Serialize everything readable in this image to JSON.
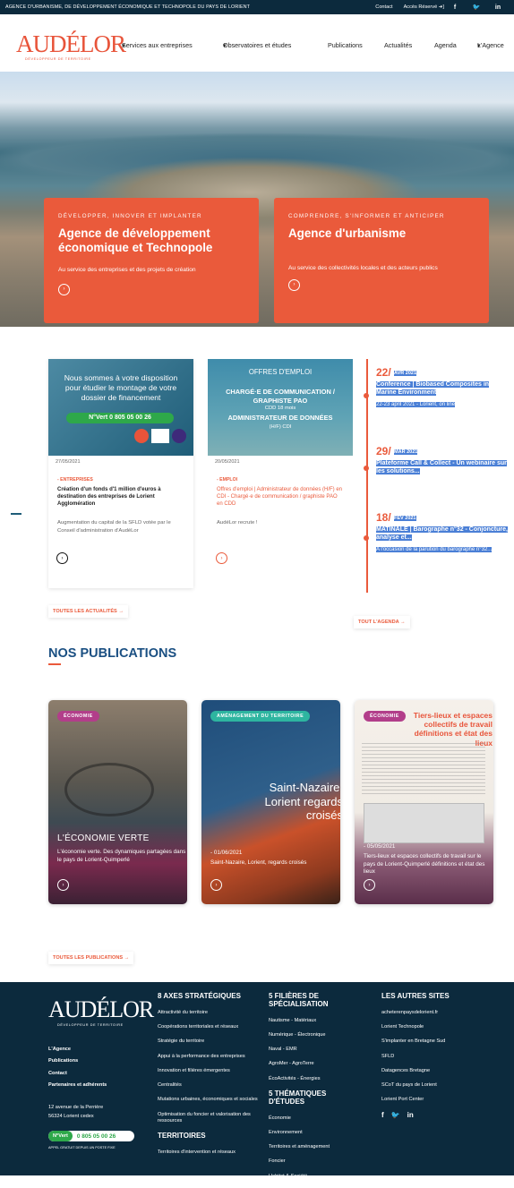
{
  "topbar": {
    "tagline": "AGENCE D'URBANISME, DE DÉVELOPPEMENT ÉCONOMIQUE ET TECHNOPOLE DU PAYS DE LORIENT",
    "contact": "Contact",
    "acces": "Accès Réservé"
  },
  "nav": {
    "logo": "AUDÉLOR",
    "logo_sub": "DÉVELOPPEUR DE TERRITOIRE",
    "items": [
      "Services aux entreprises",
      "Observatoires et études",
      "Publications",
      "Actualités",
      "Agenda",
      "L'Agence"
    ]
  },
  "hero": {
    "card1": {
      "kicker": "DÉVELOPPER, INNOVER ET IMPLANTER",
      "title": "Agence de développement économique et Technopole",
      "desc": "Au service des entreprises et des projets de création"
    },
    "card2": {
      "kicker": "COMPRENDRE, S'INFORMER ET ANTICIPER",
      "title": "Agence d'urbanisme",
      "desc": "Au service des collectivités locales et des acteurs publics"
    }
  },
  "news": [
    {
      "img_text": "Nous sommes à votre disposition pour étudier le montage de votre dossier de financement",
      "img_badge": "N°Vert 0 805 05 00 26",
      "date": "27/05/2021",
      "category": "- ENTREPRISES",
      "title": "Création d'un fonds d'1 million d'euros à destination des entreprises de Lorient Agglomération",
      "desc": "Augmentation du capital de la SFLD votée par le Conseil d'administration d'AudéLor"
    },
    {
      "img_line1": "OFFRES D'EMPLOI",
      "img_line2": "CHARGÉ·E DE COMMUNICATION / GRAPHISTE PAO",
      "img_line3": "CDD 18 mois",
      "img_line4": "ADMINISTRATEUR DE DONNÉES",
      "img_line5": "(H/F) CDI",
      "date": "20/05/2021",
      "category": "- EMPLOI",
      "title": "Offres d'emploi | Administrateur de données (H/F) en CDI - Chargé·e de communication / graphiste PAO en CDD",
      "desc": "AudéLor recrute !"
    }
  ],
  "agenda": [
    {
      "day": "22",
      "month": "AVR 2021",
      "title": "Conference | Biobased Composites in Marine Environment",
      "sub": "22-23 april 2021 - Lorient, on line"
    },
    {
      "day": "29",
      "month": "MAR 2021",
      "title": "Plateforme Call & Collect - Un webinaire sur les solutions...",
      "sub": ""
    },
    {
      "day": "18",
      "month": "FEV 2021",
      "title": "MATINALE | Barographe n°32 - Conjoncture, analyse et...",
      "sub": "A l'occasion de la parution du barographe n°32..."
    }
  ],
  "links": {
    "all_news": "TOUTES LES ACTUALITÉS →",
    "all_agenda": "TOUT L'AGENDA →",
    "all_pubs": "TOUTES LES PUBLICATIONS →"
  },
  "publications": {
    "heading": "NOS PUBLICATIONS",
    "items": [
      {
        "badge": "ÉCONOMIE",
        "cover_title": "L'ÉCONOMIE VERTE",
        "date": "",
        "title": "L'économie verte. Des dynamiques partagées dans le pays de Lorient-Quimperlé"
      },
      {
        "badge": "AMÉNAGEMENT DU TERRITOIRE",
        "cover_title": "Saint-Nazaire, Lorient regards croisés",
        "date": "- 01/06/2021",
        "title": "Saint-Nazaire, Lorient, regards croisés"
      },
      {
        "badge": "ÉCONOMIE",
        "cover_title": "Tiers-lieux et espaces collectifs de travail définitions et état des lieux",
        "date": "- 05/05/2021",
        "title": "Tiers-lieux et espaces collectifs de travail sur le pays de Lorient-Quimperlé définitions et état des lieux"
      }
    ]
  },
  "footer": {
    "logo": "AUDÉLOR",
    "logo_sub": "DÉVELOPPEUR DE TERRITOIRE",
    "links": [
      "L'Agence",
      "Publications",
      "Contact",
      "Partenaires et adhérents"
    ],
    "address1": "12 avenue de la Perrière",
    "address2": "56324 Lorient cedex",
    "phone_label": "N°Vert",
    "phone": "0 805 05 00 26",
    "phone_note": "APPEL GRATUIT DEPUIS UN POSTE FIXE",
    "col2_title": "8 AXES STRATÉGIQUES",
    "col2": [
      "Attractivité du territoire",
      "Coopérations territoriales et réseaux",
      "Stratégie du territoire",
      "Appui à la performance des entreprises",
      "Innovation et filières émergentes",
      "Centralités",
      "Mutations urbaines, économiques et sociales",
      "Optimisation du foncier et valorisation des ressources"
    ],
    "col2b_title": "TERRITOIRES",
    "col2b": [
      "Territoires d'intervention et réseaux"
    ],
    "col3_title": "5 FILIÈRES DE SPÉCIALISATION",
    "col3": [
      "Nautisme - Matériaux",
      "Numérique - Électronique",
      "Naval - EMR",
      "AgroMer - AgroTerre",
      "ÉcoActivités - Énergies"
    ],
    "col3b_title": "5 THÉMATIQUES D'ÉTUDES",
    "col3b": [
      "Économie",
      "Environnement",
      "Territoires et aménagement",
      "Foncier",
      "Habitat & Société"
    ],
    "col4_title": "LES AUTRES SITES",
    "col4": [
      "acheterenpaysdelorient.fr",
      "Lorient Technopole",
      "S'implanter en Bretagne Sud",
      "SFLD",
      "Datagences Bretagne",
      "SCoT du pays de Lorient",
      "Lorient Port Center"
    ]
  }
}
